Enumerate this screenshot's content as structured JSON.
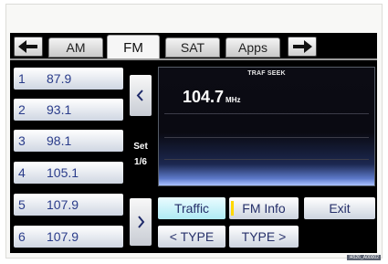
{
  "tabs": [
    {
      "label": "AM",
      "active": false
    },
    {
      "label": "FM",
      "active": true
    },
    {
      "label": "SAT",
      "active": false
    },
    {
      "label": "Apps",
      "active": false
    }
  ],
  "nav": {
    "prev_icon": "arrow-left-icon",
    "next_icon": "arrow-right-icon"
  },
  "presets": [
    {
      "num": "1",
      "freq": "87.9"
    },
    {
      "num": "2",
      "freq": "93.1"
    },
    {
      "num": "3",
      "freq": "98.1"
    },
    {
      "num": "4",
      "freq": "105.1"
    },
    {
      "num": "5",
      "freq": "107.9"
    },
    {
      "num": "6",
      "freq": "107.9"
    }
  ],
  "preset_set": {
    "label": "Set",
    "page": "1/6",
    "prev_icon": "chevron-left-icon",
    "next_icon": "chevron-right-icon"
  },
  "display": {
    "status": "TRAF SEEK",
    "frequency": "104.7",
    "unit": "MHz"
  },
  "buttons": {
    "traffic": "Traffic",
    "fm_info": "FM Info",
    "exit": "Exit",
    "type_prev": "< TYPE",
    "type_next": "TYPE >"
  },
  "image_code": "I4526_A00002"
}
